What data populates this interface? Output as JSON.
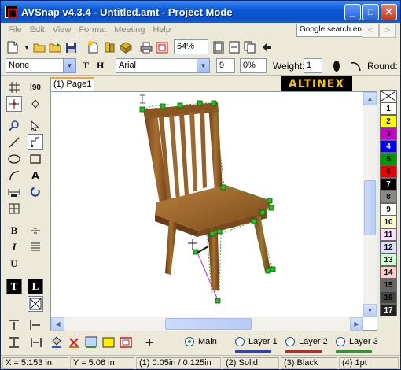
{
  "window": {
    "title": "AVSnap v4.3.4 - Untitled.amt - Project Mode",
    "minimize_glyph": "_",
    "maximize_glyph": "□",
    "close_glyph": "✕"
  },
  "menu": [
    "File",
    "Edit",
    "View",
    "Format",
    "Meeting",
    "Help"
  ],
  "toolbar": {
    "zoom": "64%",
    "search_placeholder": "Google search en",
    "nav_back": "<",
    "nav_forward": ">",
    "brand": "ALTINEX"
  },
  "format_bar": {
    "line_style": "None",
    "text_tool_label": "T",
    "hyper_label": "H",
    "font": "Arial",
    "font_size": "9",
    "opacity": "0%",
    "weight_label": "Weight:",
    "weight_value": "1",
    "round_label": "Round:"
  },
  "tab": {
    "label": "(1) Page1"
  },
  "palette": {
    "bold": "B",
    "italic": "I",
    "underline": "U",
    "text_dark_1": "T",
    "text_dark_2": "L",
    "label_a": "A"
  },
  "colors": {
    "swatches": [
      {
        "label": "",
        "bg": "#ffffff",
        "fg": "#000000"
      },
      {
        "label": "1",
        "bg": "#ffffff",
        "fg": "#000000"
      },
      {
        "label": "2",
        "bg": "#ffff00",
        "fg": "#000000"
      },
      {
        "label": "3",
        "bg": "#cc00cc",
        "fg": "#000000"
      },
      {
        "label": "4",
        "bg": "#0000ff",
        "fg": "#ffffff"
      },
      {
        "label": "5",
        "bg": "#009900",
        "fg": "#000000"
      },
      {
        "label": "6",
        "bg": "#ee0000",
        "fg": "#000000"
      },
      {
        "label": "7",
        "bg": "#000000",
        "fg": "#ffffff"
      },
      {
        "label": "8",
        "bg": "#888888",
        "fg": "#000000"
      },
      {
        "label": "9",
        "bg": "#ffffff",
        "fg": "#000000"
      },
      {
        "label": "10",
        "bg": "#ffffcc",
        "fg": "#000000"
      },
      {
        "label": "11",
        "bg": "#ffddff",
        "fg": "#000000"
      },
      {
        "label": "12",
        "bg": "#ddddff",
        "fg": "#000000"
      },
      {
        "label": "13",
        "bg": "#ccffcc",
        "fg": "#000000"
      },
      {
        "label": "14",
        "bg": "#ffcccc",
        "fg": "#000000"
      },
      {
        "label": "15",
        "bg": "#666666",
        "fg": "#000000"
      },
      {
        "label": "16",
        "bg": "#444444",
        "fg": "#000000"
      },
      {
        "label": "17",
        "bg": "#222222",
        "fg": "#ffffff"
      }
    ]
  },
  "layers": {
    "main": "Main",
    "layer1": "Layer 1",
    "layer2": "Layer 2",
    "layer3": "Layer 3",
    "selected": "Main"
  },
  "status": {
    "x": "X = 5.153 in",
    "y": "Y = 5.06 in",
    "size": "(1) 0.05in / 0.125in",
    "line": "(2) Solid",
    "color": "(3) Black",
    "weight": "(4) 1pt"
  }
}
